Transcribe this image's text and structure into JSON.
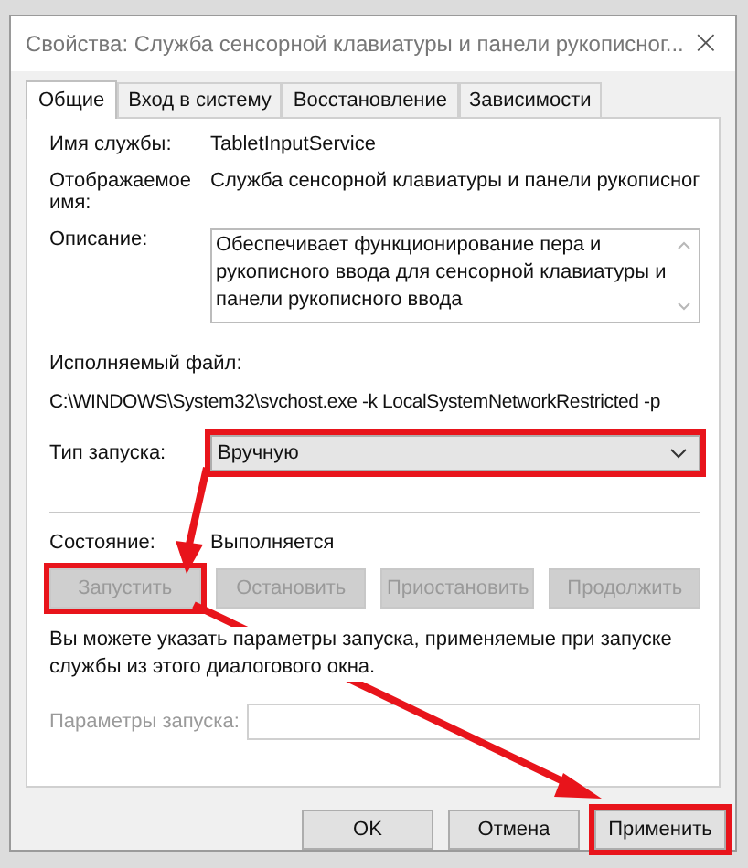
{
  "window": {
    "title": "Свойства: Служба сенсорной клавиатуры и панели рукописног...",
    "close": "×"
  },
  "tabs": [
    {
      "label": "Общие",
      "selected": true
    },
    {
      "label": "Вход в систему",
      "selected": false
    },
    {
      "label": "Восстановление",
      "selected": false
    },
    {
      "label": "Зависимости",
      "selected": false
    }
  ],
  "service_name": {
    "label": "Имя службы:",
    "value": "TabletInputService"
  },
  "display_name": {
    "label": "Отображаемое имя:",
    "value": "Служба сенсорной клавиатуры и панели рукописног"
  },
  "description": {
    "label": "Описание:",
    "value": "Обеспечивает функционирование пера и рукописного ввода для сенсорной клавиатуры и панели рукописного ввода"
  },
  "executable": {
    "label": "Исполняемый файл:",
    "value": "C:\\WINDOWS\\System32\\svchost.exe -k LocalSystemNetworkRestricted -p"
  },
  "startup_type": {
    "label": "Тип запуска:",
    "value": "Вручную",
    "highlighted": true
  },
  "status": {
    "label": "Состояние:",
    "value": "Выполняется"
  },
  "service_buttons": [
    {
      "label": "Запустить",
      "disabled": true,
      "highlighted": true
    },
    {
      "label": "Остановить",
      "disabled": true,
      "highlighted": false
    },
    {
      "label": "Приостановить",
      "disabled": true,
      "highlighted": false
    },
    {
      "label": "Продолжить",
      "disabled": true,
      "highlighted": false
    }
  ],
  "hint": "Вы можете указать параметры запуска, применяемые при запуске службы из этого диалогового окна.",
  "start_params": {
    "label": "Параметры запуска:",
    "disabled": true
  },
  "dialog_buttons": [
    {
      "label": "OK",
      "highlighted": false
    },
    {
      "label": "Отмена",
      "highlighted": false
    },
    {
      "label": "Применить",
      "highlighted": true
    }
  ]
}
